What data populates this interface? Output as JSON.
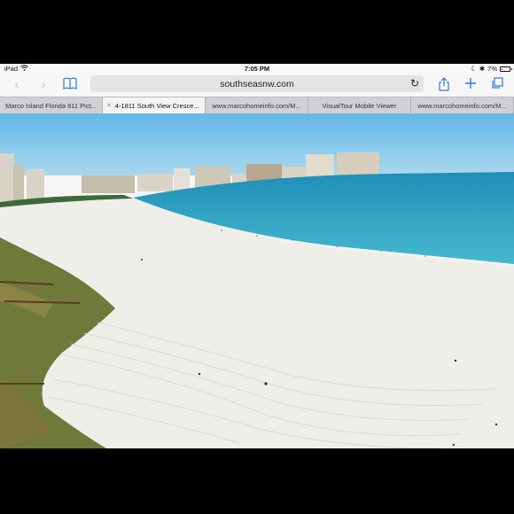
{
  "status": {
    "device": "iPad",
    "time": "7:05 PM",
    "battery": "7%",
    "battery_fraction": 0.07
  },
  "toolbar": {
    "url": "southseasnw.com",
    "back_icon": "chevron-left-icon",
    "forward_icon": "chevron-right-icon",
    "bookmarks_icon": "book-icon",
    "reload_icon": "reload-icon",
    "share_icon": "share-icon",
    "new_tab_icon": "plus-icon",
    "tabs_icon": "tabs-icon"
  },
  "tabs": [
    {
      "label": "Marco Island Florida 811 Pict...",
      "active": false
    },
    {
      "label": "4-1811 South View Cresce...",
      "active": true
    },
    {
      "label": "www.marcohomeinfo.com/M...",
      "active": false
    },
    {
      "label": "VisualTour Mobile Viewer",
      "active": false
    },
    {
      "label": "www.marcohomeinfo.com/M...",
      "active": false
    }
  ],
  "colors": {
    "accent": "#2c7be5",
    "sky": "#7fc4e8",
    "sea": "#2aa3c4",
    "sand": "#f0efe9",
    "dune": "#6b7c3c"
  }
}
